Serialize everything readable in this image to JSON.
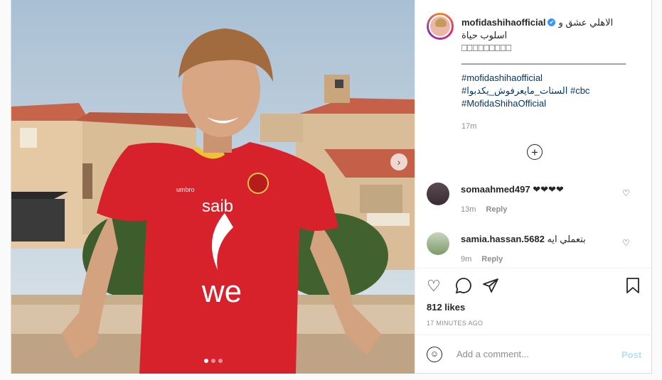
{
  "post": {
    "username": "mofidashihaofficial",
    "verified_icon": "verified-badge-icon",
    "caption_line1": "الاهلي عشق و",
    "caption_line2": "اسلوب حياة",
    "caption_line3": "⎕⎕⎕⎕⎕⎕⎕⎕⎕",
    "caption_line4": "________________________________",
    "hashtag1": "#mofidashihaofficial",
    "hashtag2": "#الستات_مايعرفوش_يكدبوا",
    "hashtag3": "#cbc",
    "hashtag4": "#MofidaShihaOfficial",
    "caption_time": "17m",
    "likes": "812 likes",
    "time_ago": "17 MINUTES AGO"
  },
  "comments": [
    {
      "username": "somaahmed497",
      "text": "❤❤❤❤",
      "time": "13m",
      "reply": "Reply"
    },
    {
      "username": "samia.hassan.5682",
      "text": "بتعملي ايه",
      "time": "9m",
      "reply": "Reply"
    }
  ],
  "composer": {
    "placeholder": "Add a comment...",
    "post_label": "Post"
  },
  "photo": {
    "jersey_sponsor": "we",
    "jersey_brand": "saib",
    "maker": "umbro"
  },
  "colors": {
    "link": "#00376b",
    "post_disabled": "#b2dffc",
    "jersey_red": "#d8222b"
  }
}
